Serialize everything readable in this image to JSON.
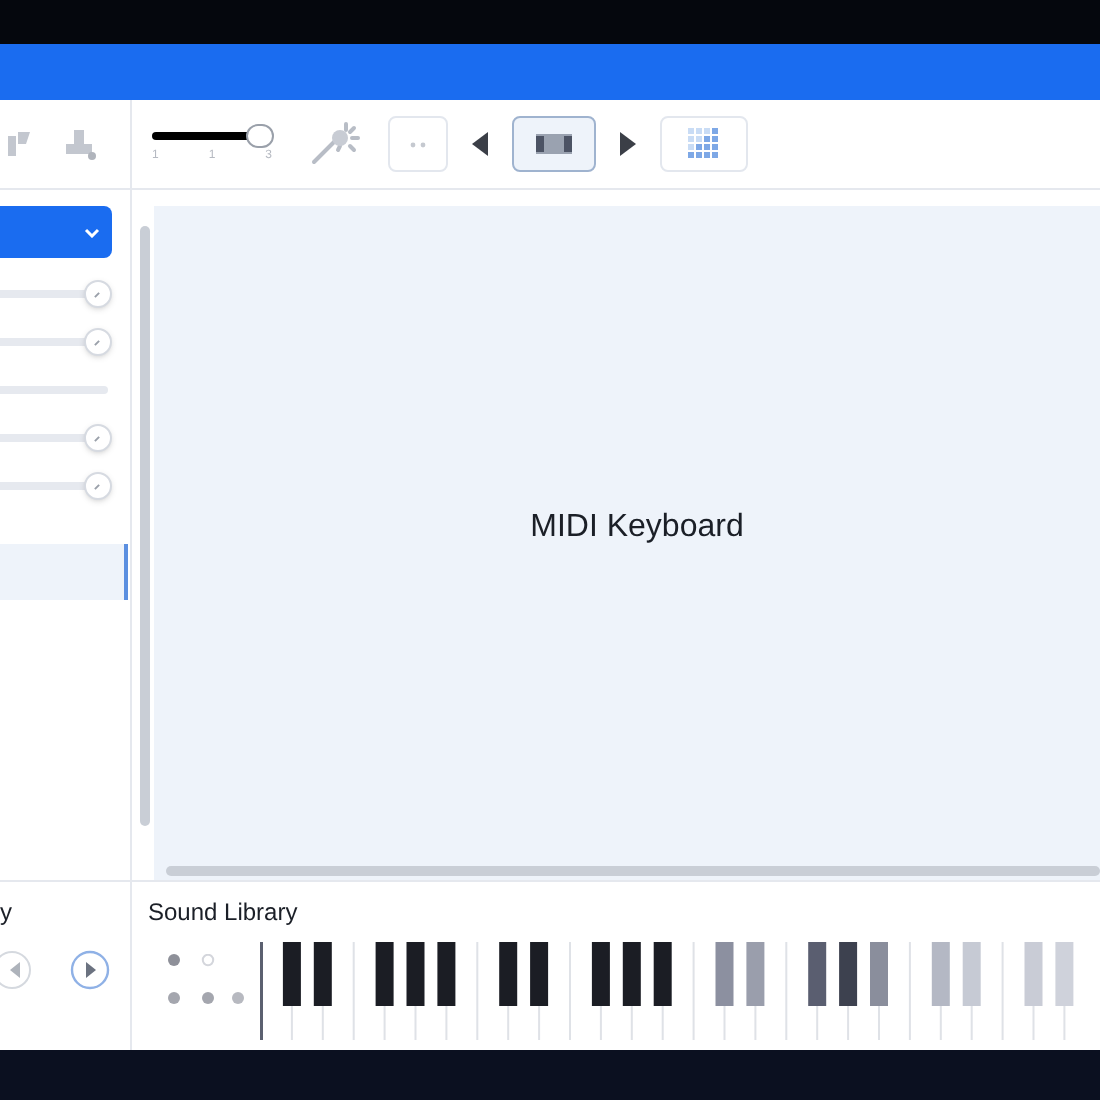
{
  "toolbar": {
    "zoom_slider": {
      "level": 0.85,
      "ticks": [
        "1",
        "1",
        "3"
      ]
    },
    "view_buttons": [
      {
        "kind": "dots",
        "selected": false
      },
      {
        "kind": "strip",
        "selected": true
      },
      {
        "kind": "grid",
        "selected": false
      }
    ]
  },
  "sidebar": {
    "dropdown": {
      "expanded": false
    },
    "sliders": [
      {
        "kind": "slider",
        "level": 0.9
      },
      {
        "kind": "slider",
        "level": 0.9
      },
      {
        "kind": "bar",
        "level": 1
      },
      {
        "kind": "slider",
        "level": 0.9
      },
      {
        "kind": "slider",
        "level": 0.9
      }
    ],
    "items": [
      {
        "selected": true
      }
    ]
  },
  "canvas": {
    "title": "MIDI Keyboard"
  },
  "transport": {
    "label": "y"
  },
  "sound_library": {
    "title": "Sound Library"
  }
}
